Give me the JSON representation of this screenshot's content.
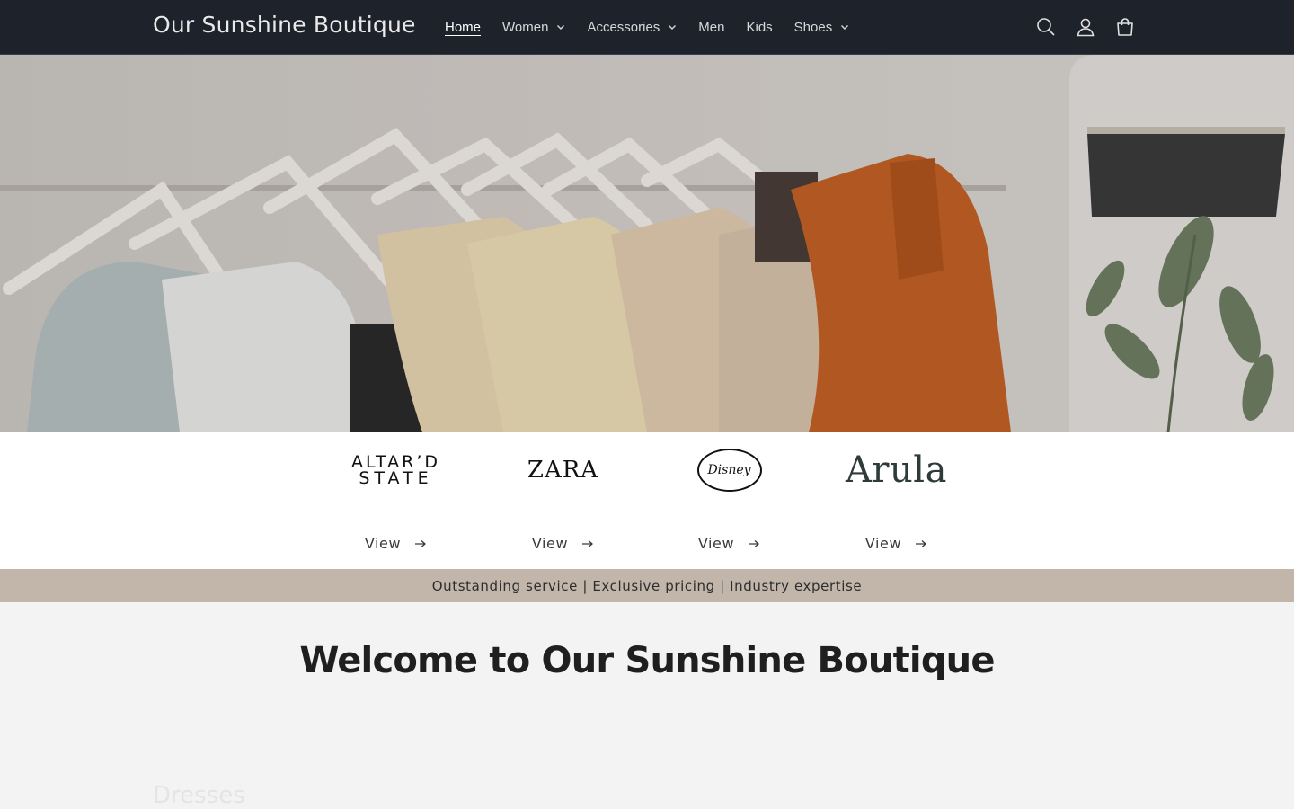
{
  "header": {
    "logo": "Our Sunshine Boutique",
    "nav": [
      {
        "label": "Home",
        "active": true,
        "dropdown": false
      },
      {
        "label": "Women",
        "active": false,
        "dropdown": true
      },
      {
        "label": "Accessories",
        "active": false,
        "dropdown": true
      },
      {
        "label": "Men",
        "active": false,
        "dropdown": false
      },
      {
        "label": "Kids",
        "active": false,
        "dropdown": false
      },
      {
        "label": "Shoes",
        "active": false,
        "dropdown": true
      }
    ],
    "icons": [
      "search-icon",
      "account-icon",
      "cart-icon"
    ]
  },
  "brands": {
    "items": [
      {
        "logo_line1": "ALTAR’D",
        "logo_line2": "STATE",
        "link": "View"
      },
      {
        "logo_text": "ZARA",
        "link": "View"
      },
      {
        "logo_text": "Disney",
        "link": "View"
      },
      {
        "logo_text": "Arula",
        "link": "View"
      }
    ]
  },
  "announcement": "Outstanding service | Exclusive pricing | Industry expertise",
  "welcome": {
    "title": "Welcome to Our Sunshine Boutique",
    "next_section": "Dresses"
  },
  "colors": {
    "header_bg": "#1e222b",
    "announcement_bg": "#c2b6ab",
    "page_bg": "#f3f3f3"
  }
}
